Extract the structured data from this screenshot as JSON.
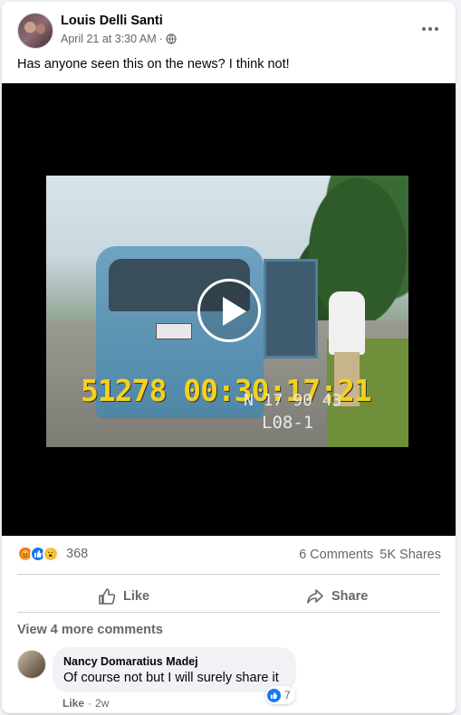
{
  "post": {
    "author": "Louis Delli Santi",
    "timestamp": "April 21 at 3:30 AM",
    "separator": "·",
    "privacy_icon": "globe-icon",
    "text": "Has anyone seen this on the news? I think not!"
  },
  "video": {
    "timecode_main": "51278 00:30:17:21",
    "timecode_secondary": "N 17 90 43",
    "tape_label": "L08-1",
    "play_icon": "play-icon"
  },
  "engagement": {
    "reaction_icons": [
      "angry-icon",
      "like-icon",
      "wow-icon"
    ],
    "reaction_count": "368",
    "comments": "6 Comments",
    "shares": "5K Shares"
  },
  "actions": {
    "like_label": "Like",
    "share_label": "Share"
  },
  "comments": {
    "view_more": "View 4 more comments",
    "items": [
      {
        "author": "Nancy Domaratius Madej",
        "text": "Of course not but I will surely share it",
        "reaction_count": "7",
        "like_label": "Like",
        "separator": "·",
        "age": "2w"
      }
    ]
  },
  "colors": {
    "accent": "#1877f2",
    "secondary_text": "#65676b",
    "timecode_yellow": "#f5d11e"
  }
}
